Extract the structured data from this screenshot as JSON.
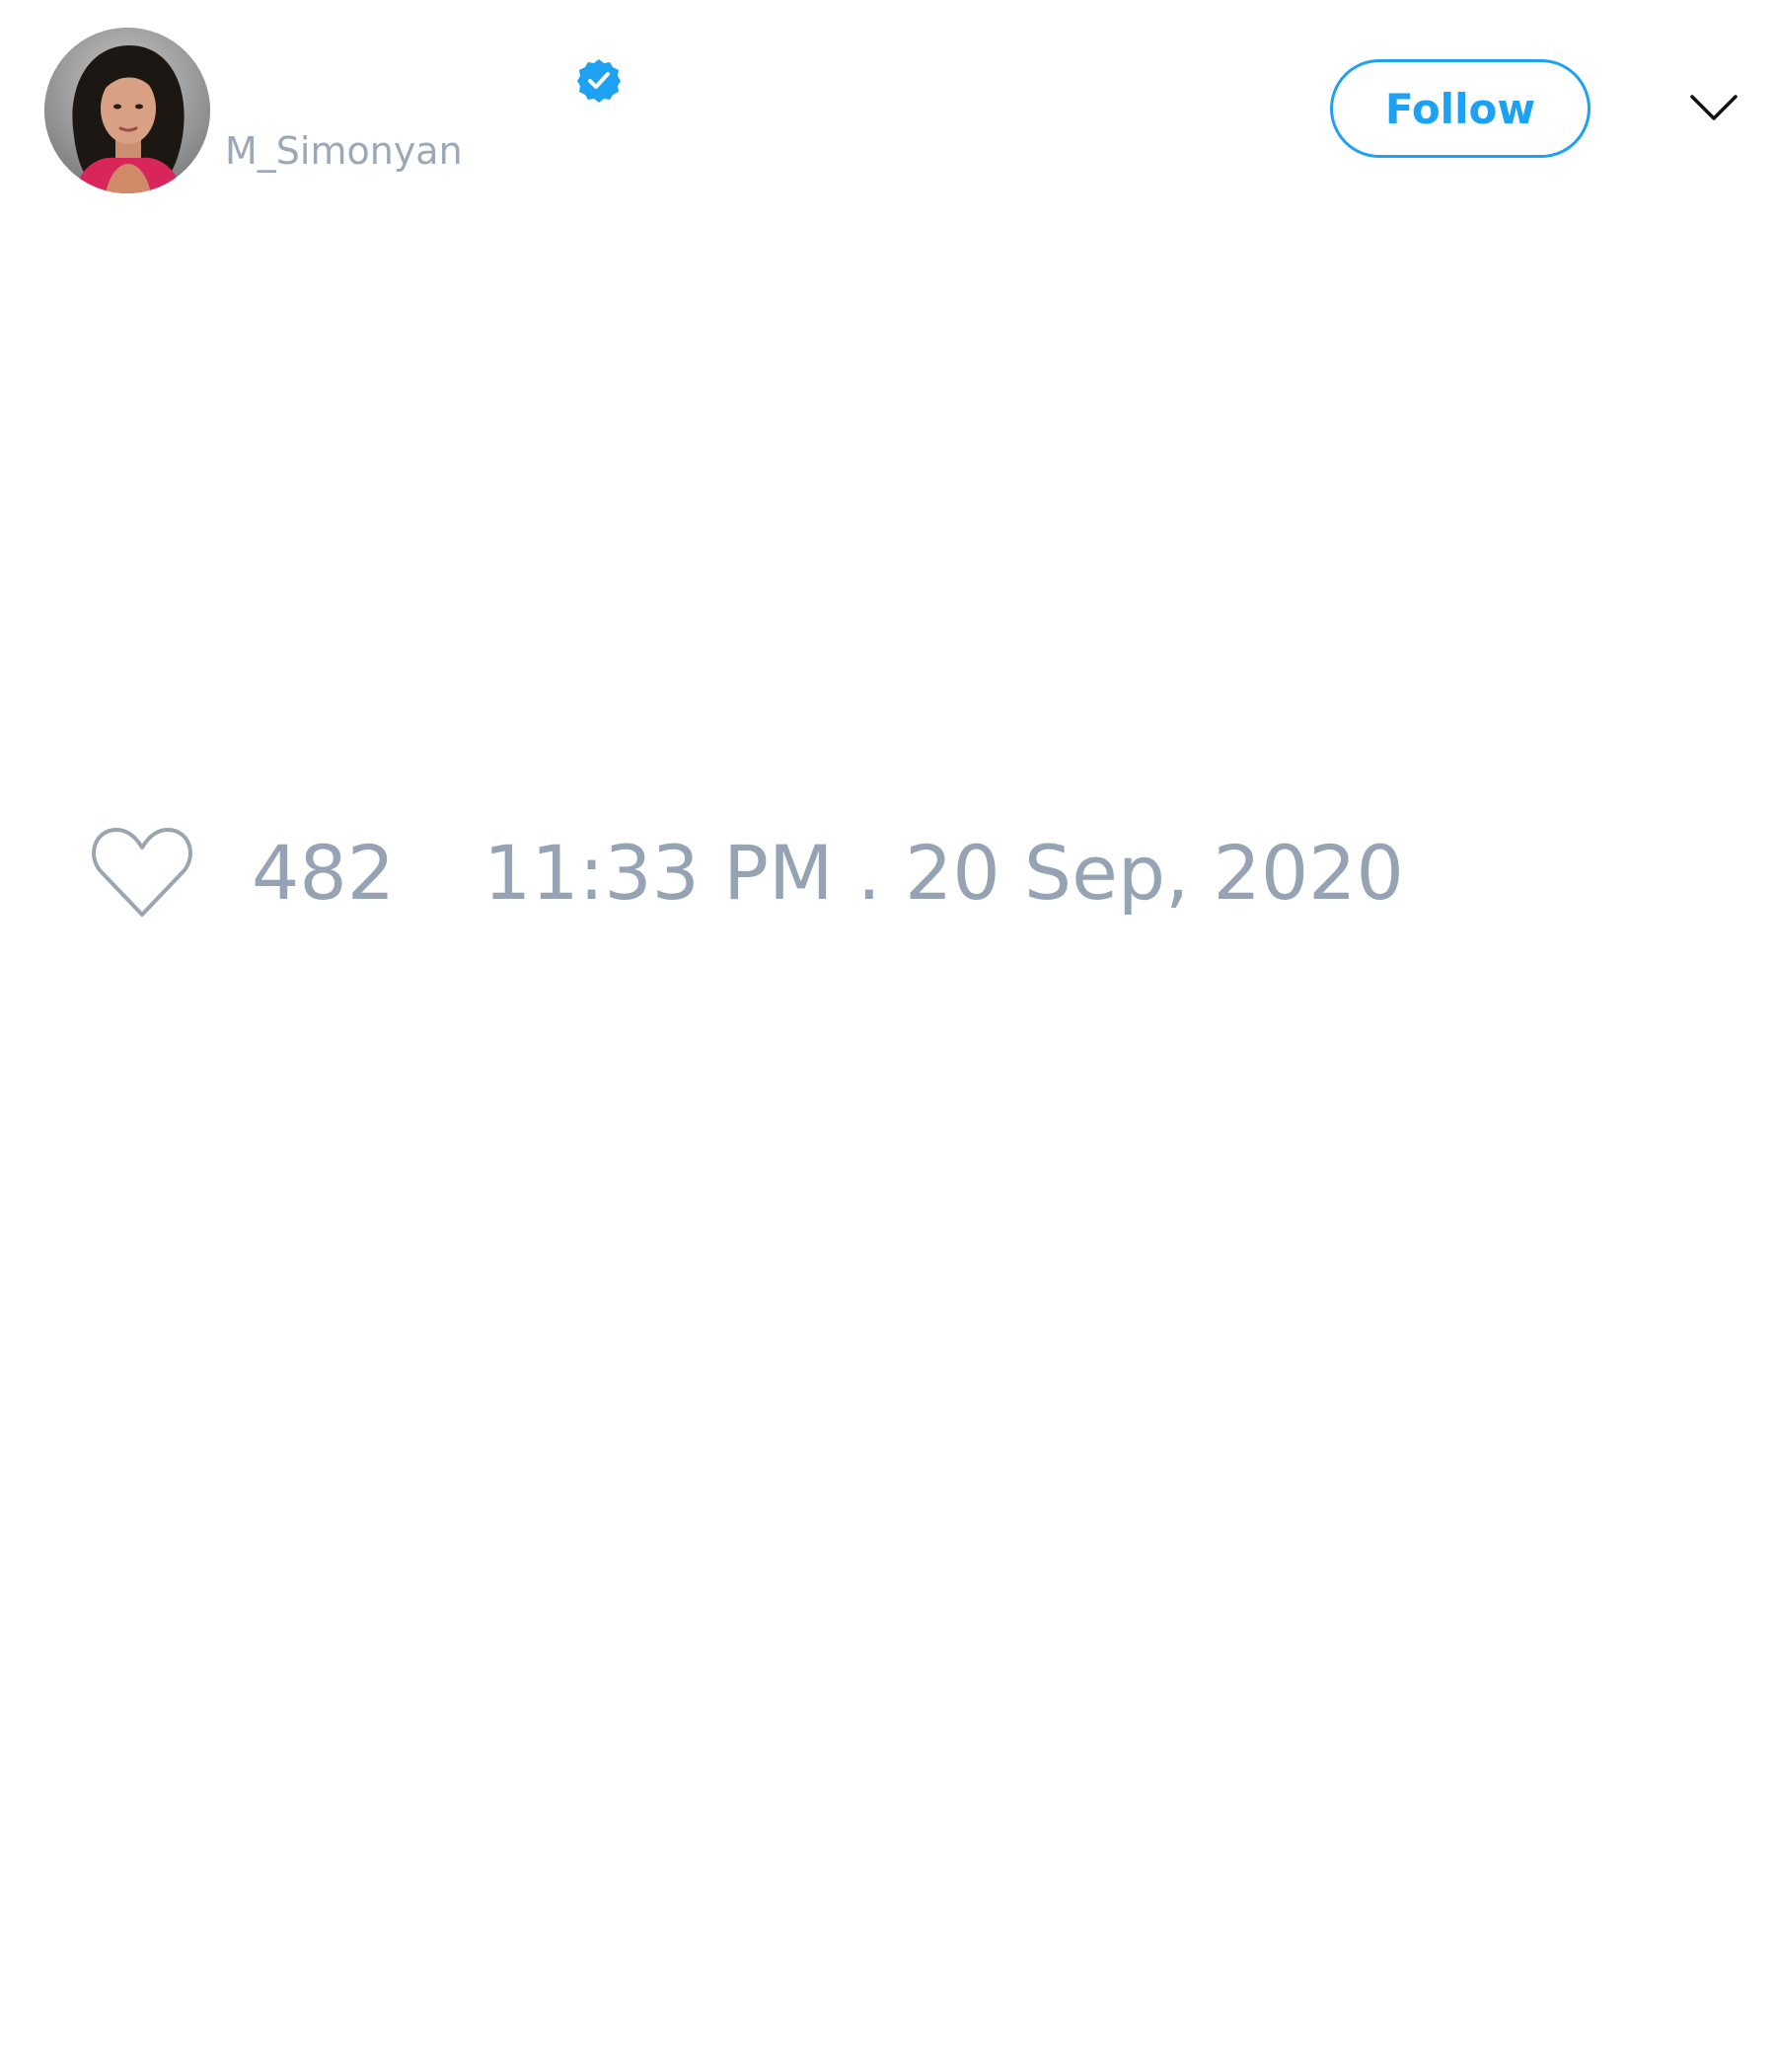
{
  "tweet": {
    "author": {
      "display_name": "",
      "handle": "M_Simonyan",
      "verified": true,
      "avatar_icon": "profile-photo"
    },
    "header": {
      "follow_label": "Follow",
      "menu_icon": "chevron-down-icon"
    },
    "footer": {
      "like_icon": "heart-outline-icon",
      "like_count": "482",
      "timestamp": "11:33 PM . 20 Sep, 2020"
    }
  },
  "colors": {
    "accent": "#1da1f2",
    "muted_text": "#95a3b4",
    "handle_text": "#9aa8b8",
    "icon_stroke": "#9aa5b1",
    "background": "#ffffff"
  }
}
